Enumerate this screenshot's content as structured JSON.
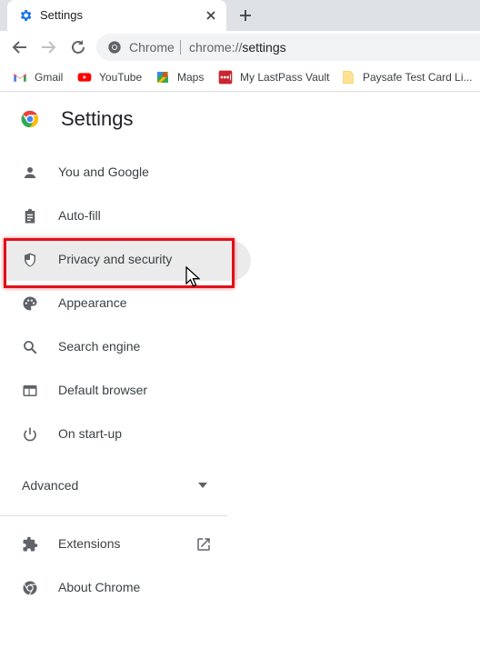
{
  "tab": {
    "title": "Settings"
  },
  "omnibox": {
    "chip": "Chrome",
    "url_scheme": "chrome://",
    "url_path": "settings"
  },
  "bookmarks": [
    {
      "label": "Gmail",
      "icon": "gmail-icon"
    },
    {
      "label": "YouTube",
      "icon": "youtube-icon"
    },
    {
      "label": "Maps",
      "icon": "maps-icon"
    },
    {
      "label": "My LastPass Vault",
      "icon": "lastpass-icon"
    },
    {
      "label": "Paysafe Test Card Li...",
      "icon": "folder-icon"
    }
  ],
  "header": {
    "title": "Settings"
  },
  "menu": [
    {
      "label": "You and Google",
      "icon": "person-icon"
    },
    {
      "label": "Auto-fill",
      "icon": "clipboard-icon"
    },
    {
      "label": "Privacy and security",
      "icon": "shield-icon",
      "selected": true
    },
    {
      "label": "Appearance",
      "icon": "palette-icon"
    },
    {
      "label": "Search engine",
      "icon": "search-icon"
    },
    {
      "label": "Default browser",
      "icon": "browser-window-icon"
    },
    {
      "label": "On start-up",
      "icon": "power-icon"
    }
  ],
  "advanced": {
    "label": "Advanced"
  },
  "footer_menu": [
    {
      "label": "Extensions",
      "icon": "puzzle-icon"
    },
    {
      "label": "About Chrome",
      "icon": "chrome-icon"
    }
  ],
  "colors": {
    "accent": "#1a73e8",
    "highlight_box": "#e0101a",
    "selected_bg": "#ebebeb",
    "icon": "#5f6368"
  }
}
